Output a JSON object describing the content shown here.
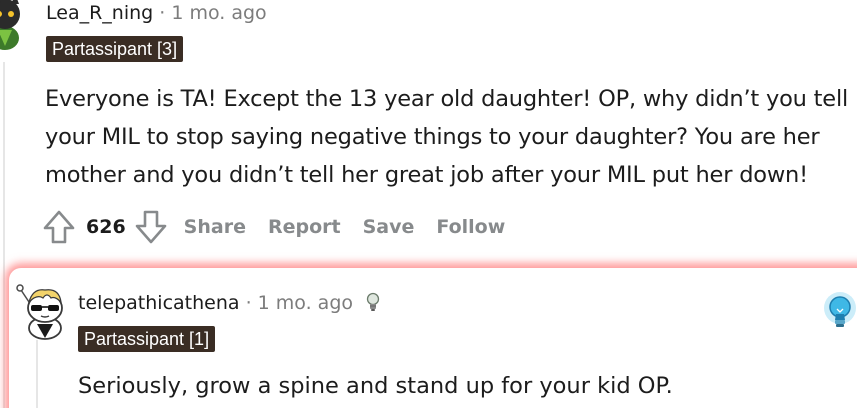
{
  "comment_1": {
    "username": "Lea_R_ning",
    "separator": " · ",
    "time_ago": "1 mo. ago",
    "flair": "Partassipant [3]",
    "body_lines": [
      "Everyone is TA! Except the 13 year old daughter! OP, why didn’t you tell",
      "your MIL to stop saying negative things to your daughter? You are her",
      "mother and you didn’t tell her great job after your MIL put her down!"
    ],
    "vote_count": "626",
    "actions": {
      "share": "Share",
      "report": "Report",
      "save": "Save",
      "follow": "Follow"
    }
  },
  "reply_1": {
    "username": "telepathicathena",
    "separator": " · ",
    "time_ago": "1 mo. ago",
    "flair": "Partassipant [1]",
    "body": "Seriously, grow a spine and stand up for your kid OP.",
    "highlight_color": "#ff6e6e"
  },
  "colors": {
    "flair_bg": "#3a2d24",
    "meta_text": "#7c7c7c",
    "action_text": "#878a8c",
    "award_blue": "#3fb8e6"
  },
  "icons": {
    "avatar_1": "snoo-avatar-dark-green",
    "avatar_2": "snoo-avatar-sunglasses",
    "upvote": "arrow-up-outline-icon",
    "downvote": "arrow-down-outline-icon",
    "helpful_award": "lightbulb-icon",
    "award": "glowing-lightbulb-award-icon"
  }
}
